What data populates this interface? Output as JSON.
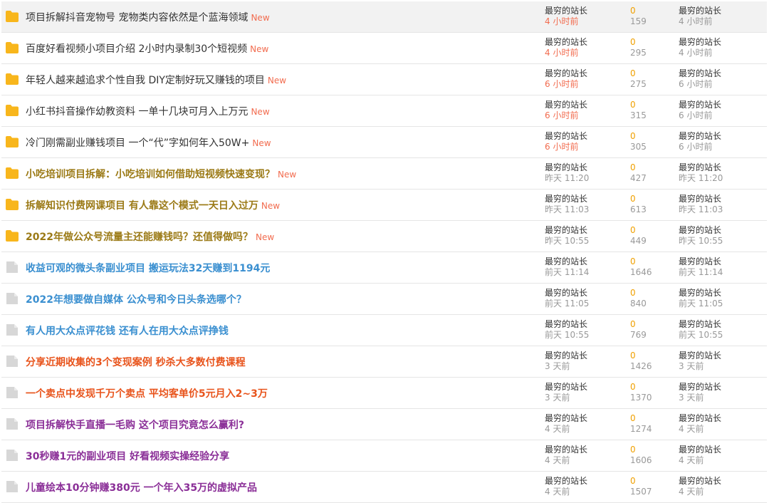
{
  "colors": {
    "folder_icon": "#f8b61c",
    "file_icon": "#d7d7d7",
    "new_badge": "#f26c4f",
    "reply_count": "#f0a000",
    "hot_time": "#f26c4f",
    "muted": "#999999",
    "title_default": "#333333",
    "title_brown": "#9b7a16",
    "title_blue": "#3a8fd0",
    "title_orange": "#e8541c",
    "title_purple": "#8a2e97",
    "row_highlight": "#f2f2f2"
  },
  "threads": [
    {
      "title": "项目拆解抖音宠物号 宠物类内容依然是个蓝海领域",
      "color": "#333333",
      "bold": false,
      "new_label": "New",
      "icon": "folder-icon",
      "author": "最穷的站长",
      "post_time": "4 小时前",
      "post_time_hot": true,
      "replies": "0",
      "views": "159",
      "last_poster": "最穷的站长",
      "last_time": "4 小时前"
    },
    {
      "title": "百度好看视频小项目介绍 2小时内录制30个短视频",
      "color": "#333333",
      "bold": false,
      "new_label": "New",
      "icon": "folder-icon",
      "author": "最穷的站长",
      "post_time": "4 小时前",
      "post_time_hot": true,
      "replies": "0",
      "views": "295",
      "last_poster": "最穷的站长",
      "last_time": "4 小时前"
    },
    {
      "title": "年轻人越来越追求个性自我 DIY定制好玩又赚钱的项目",
      "color": "#333333",
      "bold": false,
      "new_label": "New",
      "icon": "folder-icon",
      "author": "最穷的站长",
      "post_time": "6 小时前",
      "post_time_hot": true,
      "replies": "0",
      "views": "275",
      "last_poster": "最穷的站长",
      "last_time": "6 小时前"
    },
    {
      "title": "小红书抖音操作幼教资料 一单十几块可月入上万元",
      "color": "#333333",
      "bold": false,
      "new_label": "New",
      "icon": "folder-icon",
      "author": "最穷的站长",
      "post_time": "6 小时前",
      "post_time_hot": true,
      "replies": "0",
      "views": "315",
      "last_poster": "最穷的站长",
      "last_time": "6 小时前"
    },
    {
      "title": "冷门刚需副业赚钱项目 一个“代”字如何年入50W+",
      "color": "#333333",
      "bold": false,
      "new_label": "New",
      "icon": "folder-icon",
      "author": "最穷的站长",
      "post_time": "6 小时前",
      "post_time_hot": true,
      "replies": "0",
      "views": "305",
      "last_poster": "最穷的站长",
      "last_time": "6 小时前"
    },
    {
      "title": "小吃培训项目拆解：小吃培训如何借助短视频快速变现？",
      "color": "#9b7a16",
      "bold": true,
      "new_label": "New",
      "icon": "folder-icon",
      "author": "最穷的站长",
      "post_time": "昨天 11:20",
      "post_time_hot": false,
      "replies": "0",
      "views": "427",
      "last_poster": "最穷的站长",
      "last_time": "昨天 11:20"
    },
    {
      "title": "拆解知识付费网课项目 有人靠这个模式一天日入过万",
      "color": "#9b7a16",
      "bold": true,
      "new_label": "New",
      "icon": "folder-icon",
      "author": "最穷的站长",
      "post_time": "昨天 11:03",
      "post_time_hot": false,
      "replies": "0",
      "views": "613",
      "last_poster": "最穷的站长",
      "last_time": "昨天 11:03"
    },
    {
      "title": "2022年做公众号流量主还能赚钱吗？还值得做吗？",
      "color": "#9b7a16",
      "bold": true,
      "new_label": "New",
      "icon": "folder-icon",
      "author": "最穷的站长",
      "post_time": "昨天 10:55",
      "post_time_hot": false,
      "replies": "0",
      "views": "449",
      "last_poster": "最穷的站长",
      "last_time": "昨天 10:55"
    },
    {
      "title": "收益可观的微头条副业项目 搬运玩法32天赚到1194元",
      "color": "#3a8fd0",
      "bold": true,
      "new_label": "",
      "icon": "file-icon",
      "author": "最穷的站长",
      "post_time": "前天 11:14",
      "post_time_hot": false,
      "replies": "0",
      "views": "1646",
      "last_poster": "最穷的站长",
      "last_time": "前天 11:14"
    },
    {
      "title": "2022年想要做自媒体 公众号和今日头条选哪个？",
      "color": "#3a8fd0",
      "bold": true,
      "new_label": "",
      "icon": "file-icon",
      "author": "最穷的站长",
      "post_time": "前天 11:05",
      "post_time_hot": false,
      "replies": "0",
      "views": "840",
      "last_poster": "最穷的站长",
      "last_time": "前天 11:05"
    },
    {
      "title": "有人用大众点评花钱 还有人在用大众点评挣钱",
      "color": "#3a8fd0",
      "bold": true,
      "new_label": "",
      "icon": "file-icon",
      "author": "最穷的站长",
      "post_time": "前天 10:55",
      "post_time_hot": false,
      "replies": "0",
      "views": "769",
      "last_poster": "最穷的站长",
      "last_time": "前天 10:55"
    },
    {
      "title": "分享近期收集的3个变现案例 秒杀大多数付费课程",
      "color": "#e8541c",
      "bold": true,
      "new_label": "",
      "icon": "file-icon",
      "author": "最穷的站长",
      "post_time": "3 天前",
      "post_time_hot": false,
      "replies": "0",
      "views": "1426",
      "last_poster": "最穷的站长",
      "last_time": "3 天前"
    },
    {
      "title": "一个卖点中发现千万个卖点 平均客单价5元月入2~3万",
      "color": "#e8541c",
      "bold": true,
      "new_label": "",
      "icon": "file-icon",
      "author": "最穷的站长",
      "post_time": "3 天前",
      "post_time_hot": false,
      "replies": "0",
      "views": "1370",
      "last_poster": "最穷的站长",
      "last_time": "3 天前"
    },
    {
      "title": "项目拆解快手直播一毛购 这个项目究竟怎么赢利?",
      "color": "#8a2e97",
      "bold": true,
      "new_label": "",
      "icon": "file-icon",
      "author": "最穷的站长",
      "post_time": "4 天前",
      "post_time_hot": false,
      "replies": "0",
      "views": "1274",
      "last_poster": "最穷的站长",
      "last_time": "4 天前"
    },
    {
      "title": "30秒赚1元的副业项目 好看视频实操经验分享",
      "color": "#8a2e97",
      "bold": true,
      "new_label": "",
      "icon": "file-icon",
      "author": "最穷的站长",
      "post_time": "4 天前",
      "post_time_hot": false,
      "replies": "0",
      "views": "1606",
      "last_poster": "最穷的站长",
      "last_time": "4 天前"
    },
    {
      "title": "儿童绘本10分钟赚380元 一个年入35万的虚拟产品",
      "color": "#8a2e97",
      "bold": true,
      "new_label": "",
      "icon": "file-icon",
      "author": "最穷的站长",
      "post_time": "4 天前",
      "post_time_hot": false,
      "replies": "0",
      "views": "1507",
      "last_poster": "最穷的站长",
      "last_time": "4 天前"
    }
  ]
}
